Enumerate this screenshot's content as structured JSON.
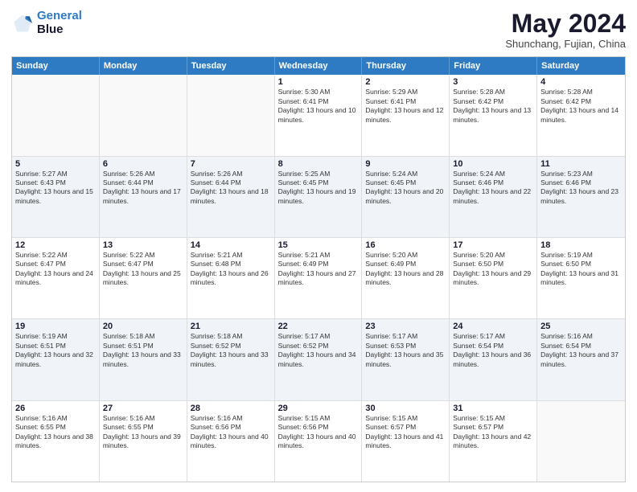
{
  "header": {
    "logo": {
      "line1": "General",
      "line2": "Blue"
    },
    "title": "May 2024",
    "subtitle": "Shunchang, Fujian, China"
  },
  "days_of_week": [
    "Sunday",
    "Monday",
    "Tuesday",
    "Wednesday",
    "Thursday",
    "Friday",
    "Saturday"
  ],
  "weeks": [
    {
      "cells": [
        {
          "day": "",
          "empty": true
        },
        {
          "day": "",
          "empty": true
        },
        {
          "day": "",
          "empty": true
        },
        {
          "day": "1",
          "rise": "Sunrise: 5:30 AM",
          "set": "Sunset: 6:41 PM",
          "daylight": "Daylight: 13 hours and 10 minutes."
        },
        {
          "day": "2",
          "rise": "Sunrise: 5:29 AM",
          "set": "Sunset: 6:41 PM",
          "daylight": "Daylight: 13 hours and 12 minutes."
        },
        {
          "day": "3",
          "rise": "Sunrise: 5:28 AM",
          "set": "Sunset: 6:42 PM",
          "daylight": "Daylight: 13 hours and 13 minutes."
        },
        {
          "day": "4",
          "rise": "Sunrise: 5:28 AM",
          "set": "Sunset: 6:42 PM",
          "daylight": "Daylight: 13 hours and 14 minutes."
        }
      ]
    },
    {
      "cells": [
        {
          "day": "5",
          "rise": "Sunrise: 5:27 AM",
          "set": "Sunset: 6:43 PM",
          "daylight": "Daylight: 13 hours and 15 minutes."
        },
        {
          "day": "6",
          "rise": "Sunrise: 5:26 AM",
          "set": "Sunset: 6:44 PM",
          "daylight": "Daylight: 13 hours and 17 minutes."
        },
        {
          "day": "7",
          "rise": "Sunrise: 5:26 AM",
          "set": "Sunset: 6:44 PM",
          "daylight": "Daylight: 13 hours and 18 minutes."
        },
        {
          "day": "8",
          "rise": "Sunrise: 5:25 AM",
          "set": "Sunset: 6:45 PM",
          "daylight": "Daylight: 13 hours and 19 minutes."
        },
        {
          "day": "9",
          "rise": "Sunrise: 5:24 AM",
          "set": "Sunset: 6:45 PM",
          "daylight": "Daylight: 13 hours and 20 minutes."
        },
        {
          "day": "10",
          "rise": "Sunrise: 5:24 AM",
          "set": "Sunset: 6:46 PM",
          "daylight": "Daylight: 13 hours and 22 minutes."
        },
        {
          "day": "11",
          "rise": "Sunrise: 5:23 AM",
          "set": "Sunset: 6:46 PM",
          "daylight": "Daylight: 13 hours and 23 minutes."
        }
      ]
    },
    {
      "cells": [
        {
          "day": "12",
          "rise": "Sunrise: 5:22 AM",
          "set": "Sunset: 6:47 PM",
          "daylight": "Daylight: 13 hours and 24 minutes."
        },
        {
          "day": "13",
          "rise": "Sunrise: 5:22 AM",
          "set": "Sunset: 6:47 PM",
          "daylight": "Daylight: 13 hours and 25 minutes."
        },
        {
          "day": "14",
          "rise": "Sunrise: 5:21 AM",
          "set": "Sunset: 6:48 PM",
          "daylight": "Daylight: 13 hours and 26 minutes."
        },
        {
          "day": "15",
          "rise": "Sunrise: 5:21 AM",
          "set": "Sunset: 6:49 PM",
          "daylight": "Daylight: 13 hours and 27 minutes."
        },
        {
          "day": "16",
          "rise": "Sunrise: 5:20 AM",
          "set": "Sunset: 6:49 PM",
          "daylight": "Daylight: 13 hours and 28 minutes."
        },
        {
          "day": "17",
          "rise": "Sunrise: 5:20 AM",
          "set": "Sunset: 6:50 PM",
          "daylight": "Daylight: 13 hours and 29 minutes."
        },
        {
          "day": "18",
          "rise": "Sunrise: 5:19 AM",
          "set": "Sunset: 6:50 PM",
          "daylight": "Daylight: 13 hours and 31 minutes."
        }
      ]
    },
    {
      "cells": [
        {
          "day": "19",
          "rise": "Sunrise: 5:19 AM",
          "set": "Sunset: 6:51 PM",
          "daylight": "Daylight: 13 hours and 32 minutes."
        },
        {
          "day": "20",
          "rise": "Sunrise: 5:18 AM",
          "set": "Sunset: 6:51 PM",
          "daylight": "Daylight: 13 hours and 33 minutes."
        },
        {
          "day": "21",
          "rise": "Sunrise: 5:18 AM",
          "set": "Sunset: 6:52 PM",
          "daylight": "Daylight: 13 hours and 33 minutes."
        },
        {
          "day": "22",
          "rise": "Sunrise: 5:17 AM",
          "set": "Sunset: 6:52 PM",
          "daylight": "Daylight: 13 hours and 34 minutes."
        },
        {
          "day": "23",
          "rise": "Sunrise: 5:17 AM",
          "set": "Sunset: 6:53 PM",
          "daylight": "Daylight: 13 hours and 35 minutes."
        },
        {
          "day": "24",
          "rise": "Sunrise: 5:17 AM",
          "set": "Sunset: 6:54 PM",
          "daylight": "Daylight: 13 hours and 36 minutes."
        },
        {
          "day": "25",
          "rise": "Sunrise: 5:16 AM",
          "set": "Sunset: 6:54 PM",
          "daylight": "Daylight: 13 hours and 37 minutes."
        }
      ]
    },
    {
      "cells": [
        {
          "day": "26",
          "rise": "Sunrise: 5:16 AM",
          "set": "Sunset: 6:55 PM",
          "daylight": "Daylight: 13 hours and 38 minutes."
        },
        {
          "day": "27",
          "rise": "Sunrise: 5:16 AM",
          "set": "Sunset: 6:55 PM",
          "daylight": "Daylight: 13 hours and 39 minutes."
        },
        {
          "day": "28",
          "rise": "Sunrise: 5:16 AM",
          "set": "Sunset: 6:56 PM",
          "daylight": "Daylight: 13 hours and 40 minutes."
        },
        {
          "day": "29",
          "rise": "Sunrise: 5:15 AM",
          "set": "Sunset: 6:56 PM",
          "daylight": "Daylight: 13 hours and 40 minutes."
        },
        {
          "day": "30",
          "rise": "Sunrise: 5:15 AM",
          "set": "Sunset: 6:57 PM",
          "daylight": "Daylight: 13 hours and 41 minutes."
        },
        {
          "day": "31",
          "rise": "Sunrise: 5:15 AM",
          "set": "Sunset: 6:57 PM",
          "daylight": "Daylight: 13 hours and 42 minutes."
        },
        {
          "day": "",
          "empty": true
        }
      ]
    }
  ]
}
